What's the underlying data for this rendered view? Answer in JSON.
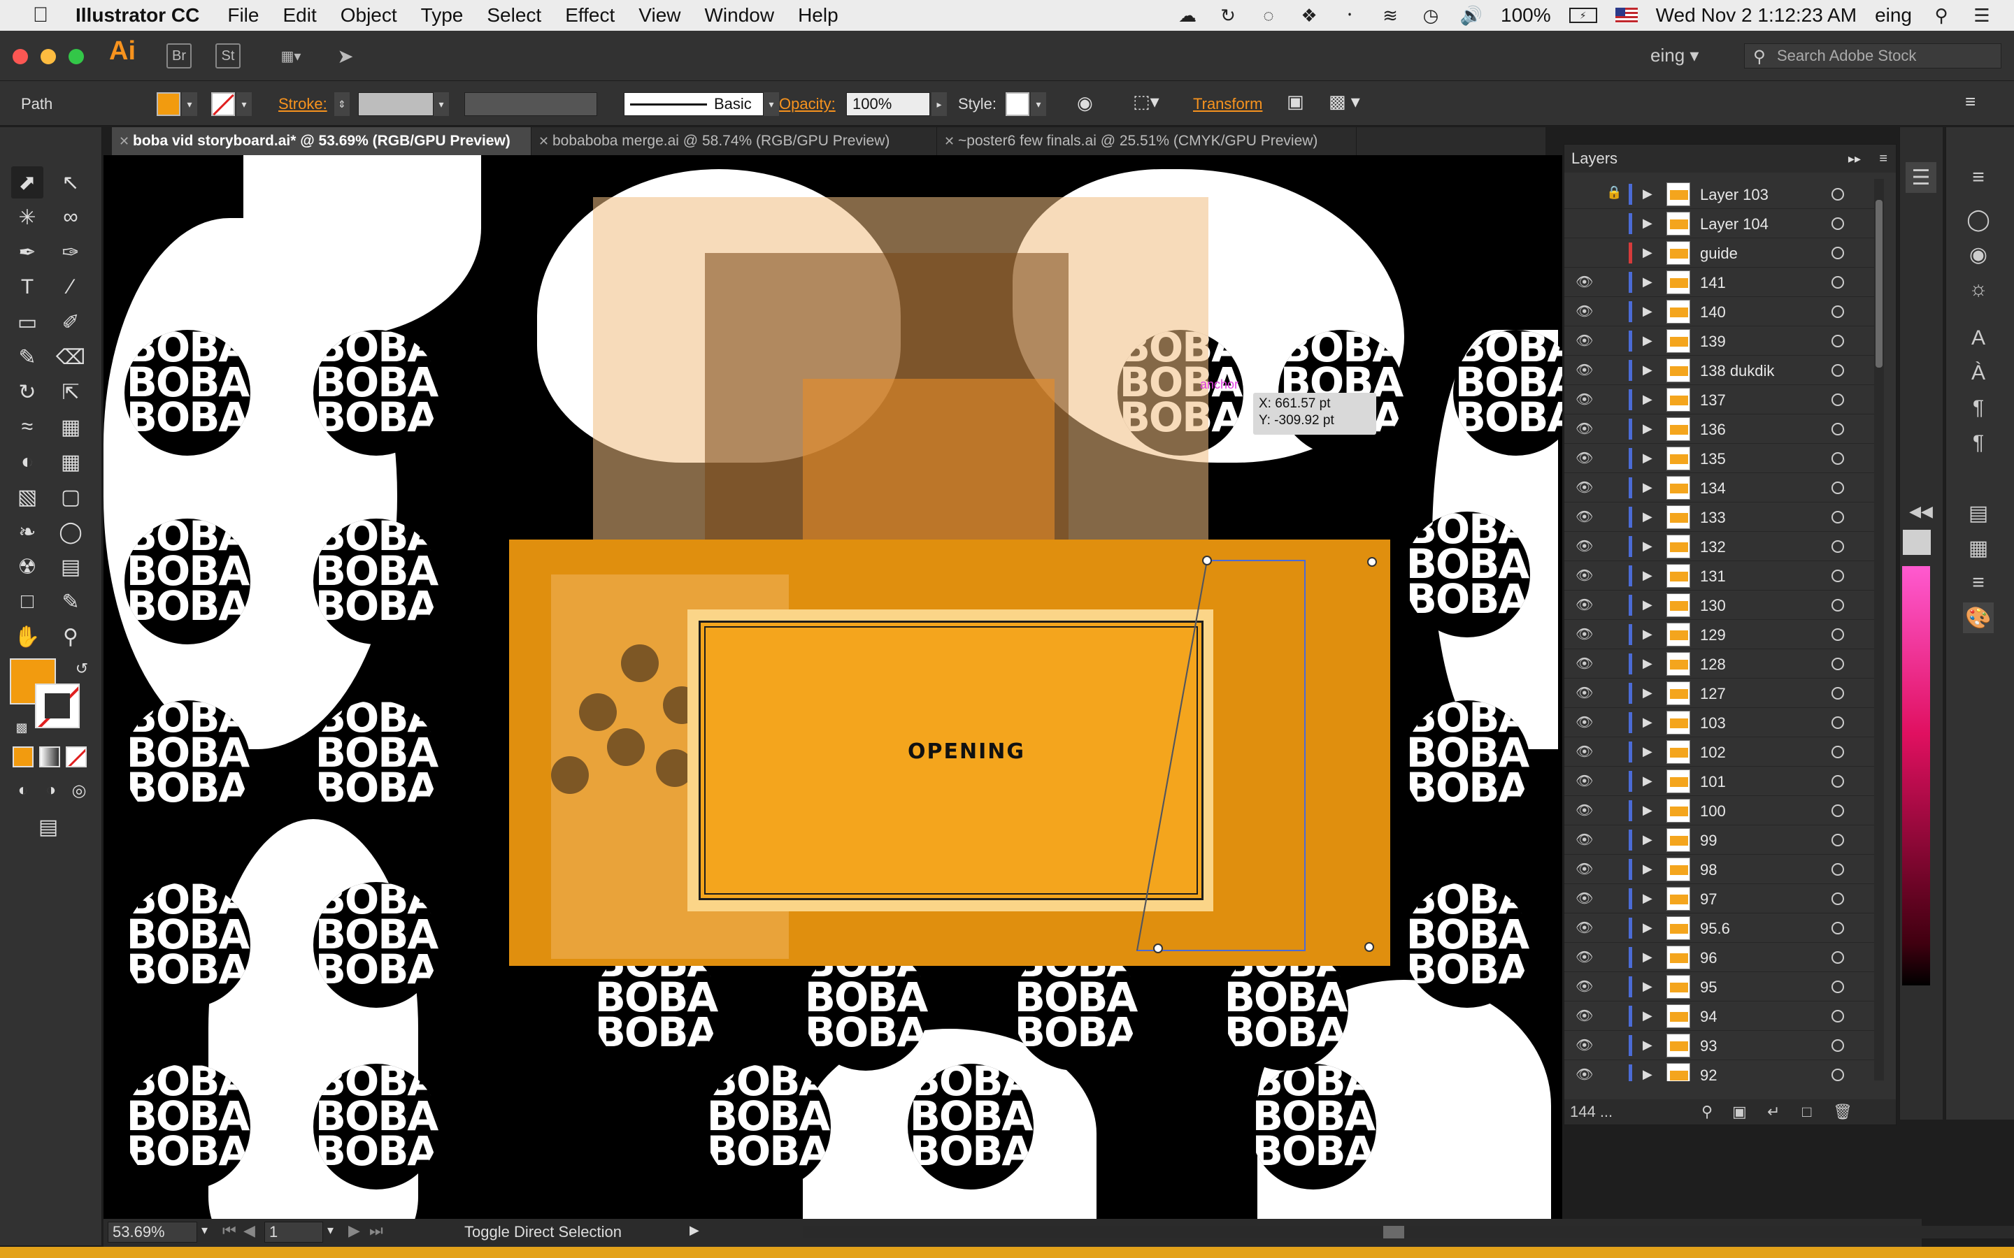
{
  "menubar": {
    "app_name": "Illustrator CC",
    "items": [
      "File",
      "Edit",
      "Object",
      "Type",
      "Select",
      "Effect",
      "View",
      "Window",
      "Help"
    ],
    "battery": "100%",
    "datetime": "Wed Nov 2  1:12:23 AM",
    "user": "eing"
  },
  "appbar": {
    "logo": "Ai",
    "bridge": "Br",
    "stock": "St",
    "workspace": "eing",
    "search_placeholder": "Search Adobe Stock"
  },
  "control": {
    "object_type": "Path",
    "stroke_label": "Stroke:",
    "brush_label": "Basic",
    "opacity_label": "Opacity:",
    "opacity_value": "100%",
    "style_label": "Style:",
    "transform_label": "Transform",
    "fill_color": "#f29b0f",
    "stroke_color": "#e02020"
  },
  "tabs": [
    {
      "label": "boba vid storyboard.ai* @ 53.69% (RGB/GPU Preview)",
      "active": true
    },
    {
      "label": "bobaboba merge.ai @ 58.74% (RGB/GPU Preview)",
      "active": false
    },
    {
      "label": "~poster6 few finals.ai @ 25.51% (CMYK/GPU Preview)",
      "active": false
    }
  ],
  "canvas": {
    "pattern_text": [
      "BOBA",
      "BOBA",
      "BOBA"
    ],
    "artboard_label": "OPENING",
    "anchor_label": "anchor",
    "coord_x": "X: 661.57 pt",
    "coord_y": "Y: -309.92 pt",
    "accent": "#f4a51d",
    "accent_dark": "#e08f0e"
  },
  "layers_panel": {
    "title": "Layers",
    "count": "144 ...",
    "rows": [
      {
        "name": "Layer 103",
        "visible": false,
        "locked": true,
        "color": "#4b6bd6"
      },
      {
        "name": "Layer 104",
        "visible": false,
        "locked": false,
        "color": "#4b6bd6"
      },
      {
        "name": "guide",
        "visible": false,
        "locked": false,
        "color": "#d63b3b"
      },
      {
        "name": "141",
        "visible": true,
        "locked": false,
        "color": "#4b6bd6"
      },
      {
        "name": "140",
        "visible": true,
        "locked": false,
        "color": "#4b6bd6"
      },
      {
        "name": "139",
        "visible": true,
        "locked": false,
        "color": "#4b6bd6"
      },
      {
        "name": "138 dukdik",
        "visible": true,
        "locked": false,
        "color": "#4b6bd6"
      },
      {
        "name": "137",
        "visible": true,
        "locked": false,
        "color": "#4b6bd6"
      },
      {
        "name": "136",
        "visible": true,
        "locked": false,
        "color": "#4b6bd6"
      },
      {
        "name": "135",
        "visible": true,
        "locked": false,
        "color": "#4b6bd6"
      },
      {
        "name": "134",
        "visible": true,
        "locked": false,
        "color": "#4b6bd6"
      },
      {
        "name": "133",
        "visible": true,
        "locked": false,
        "color": "#4b6bd6"
      },
      {
        "name": "132",
        "visible": true,
        "locked": false,
        "color": "#4b6bd6"
      },
      {
        "name": "131",
        "visible": true,
        "locked": false,
        "color": "#4b6bd6"
      },
      {
        "name": "130",
        "visible": true,
        "locked": false,
        "color": "#4b6bd6"
      },
      {
        "name": "129",
        "visible": true,
        "locked": false,
        "color": "#4b6bd6"
      },
      {
        "name": "128",
        "visible": true,
        "locked": false,
        "color": "#4b6bd6"
      },
      {
        "name": "127",
        "visible": true,
        "locked": false,
        "color": "#4b6bd6"
      },
      {
        "name": "103",
        "visible": true,
        "locked": false,
        "color": "#4b6bd6"
      },
      {
        "name": "102",
        "visible": true,
        "locked": false,
        "color": "#4b6bd6"
      },
      {
        "name": "101",
        "visible": true,
        "locked": false,
        "color": "#4b6bd6"
      },
      {
        "name": "100",
        "visible": true,
        "locked": false,
        "color": "#4b6bd6"
      },
      {
        "name": "99",
        "visible": true,
        "locked": false,
        "color": "#4b6bd6"
      },
      {
        "name": "98",
        "visible": true,
        "locked": false,
        "color": "#4b6bd6"
      },
      {
        "name": "97",
        "visible": true,
        "locked": false,
        "color": "#4b6bd6"
      },
      {
        "name": "95.6",
        "visible": true,
        "locked": false,
        "color": "#4b6bd6"
      },
      {
        "name": "96",
        "visible": true,
        "locked": false,
        "color": "#4b6bd6"
      },
      {
        "name": "95",
        "visible": true,
        "locked": false,
        "color": "#4b6bd6"
      },
      {
        "name": "94",
        "visible": true,
        "locked": false,
        "color": "#4b6bd6"
      },
      {
        "name": "93",
        "visible": true,
        "locked": false,
        "color": "#4b6bd6"
      },
      {
        "name": "92",
        "visible": true,
        "locked": false,
        "color": "#4b6bd6"
      }
    ]
  },
  "statusbar": {
    "zoom": "53.69%",
    "artboard": "1",
    "status_text": "Toggle Direct Selection"
  }
}
